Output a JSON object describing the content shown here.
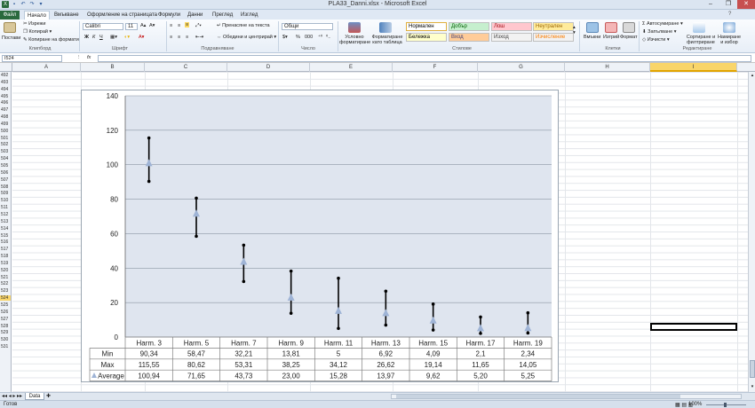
{
  "window": {
    "title": "PLA33_Danni.xlsx - Microsoft Excel",
    "controls": [
      "–",
      "❐",
      "✕"
    ]
  },
  "tabs": [
    "Файл",
    "Начало",
    "Вмъкване",
    "Оформление на страницата",
    "Формули",
    "Данни",
    "Преглед",
    "Изглед"
  ],
  "ribbon": {
    "clipboard": {
      "paste": "Постави",
      "cut": "Изрежи",
      "copy": "Копирай",
      "format_painter": "Копиране на формати",
      "label": "Клипборд"
    },
    "font": {
      "name": "Calibri",
      "size": "11",
      "label": "Шрифт"
    },
    "alignment": {
      "wrap": "Пренасяне на текста",
      "merge": "Обедини и центрирай",
      "label": "Подравняване"
    },
    "number": {
      "format": "Общи",
      "percent": "%",
      "comma": "000",
      "label": "Число"
    },
    "styles": {
      "conditional": "Условно форматиране",
      "as_table": "Форматиране като таблица",
      "label": "Стилове",
      "cells": [
        {
          "name": "Нормален",
          "bg": "#ffffff",
          "fg": "#000000"
        },
        {
          "name": "Добър",
          "bg": "#c6efce",
          "fg": "#006100"
        },
        {
          "name": "Лош",
          "bg": "#ffc7ce",
          "fg": "#9c0006"
        },
        {
          "name": "Неутрален",
          "bg": "#ffeb9c",
          "fg": "#9c6500"
        },
        {
          "name": "Бележка",
          "bg": "#ffffcc",
          "fg": "#000000"
        },
        {
          "name": "Вход",
          "bg": "#ffcc99",
          "fg": "#3f3f76"
        },
        {
          "name": "Изход",
          "bg": "#f2f2f2",
          "fg": "#3f3f3f"
        },
        {
          "name": "Изчисление",
          "bg": "#f2f2f2",
          "fg": "#fa7d00"
        }
      ]
    },
    "cells": {
      "insert": "Вмъкни",
      "delete": "Изтрий",
      "format": "Формат",
      "label": "Клетки"
    },
    "editing": {
      "autosum": "Автосумиране",
      "fill": "Запълване",
      "clear": "Изчисти",
      "sort": "Сортиране и филтриране",
      "find": "Намиране и избор",
      "label": "Редактиране"
    }
  },
  "formula_bar": {
    "name_box": "I524",
    "fx": "fx",
    "value": ""
  },
  "columns": [
    "A",
    "B",
    "C",
    "D",
    "E",
    "F",
    "G",
    "H",
    "I"
  ],
  "rows": [
    "492",
    "493",
    "494",
    "495",
    "496",
    "497",
    "498",
    "499",
    "500",
    "501",
    "502",
    "503",
    "504",
    "505",
    "506",
    "507",
    "508",
    "509",
    "510",
    "511",
    "512",
    "513",
    "514",
    "515",
    "516",
    "517",
    "518",
    "519",
    "520",
    "521",
    "522",
    "523",
    "524",
    "525",
    "526",
    "527",
    "528",
    "529",
    "530",
    "531"
  ],
  "sheet_tab": "Data",
  "status": {
    "ready": "Готов",
    "zoom": "100%"
  },
  "chart_data": {
    "type": "table",
    "chart_kind": "stock high-low-average with data table",
    "categories": [
      "Harm. 3",
      "Harm. 5",
      "Harm. 7",
      "Harm. 9",
      "Harm. 11",
      "Harm. 13",
      "Harm. 15",
      "Harm. 17",
      "Harm. 19"
    ],
    "series": [
      {
        "name": "Min",
        "labels": [
          "90,34",
          "58,47",
          "32,21",
          "13,81",
          "5",
          "6,92",
          "4,09",
          "2,1",
          "2,34"
        ],
        "values": [
          90.34,
          58.47,
          32.21,
          13.81,
          5,
          6.92,
          4.09,
          2.1,
          2.34
        ]
      },
      {
        "name": "Max",
        "labels": [
          "115,55",
          "80,62",
          "53,31",
          "38,25",
          "34,12",
          "26,62",
          "19,14",
          "11,65",
          "14,05"
        ],
        "values": [
          115.55,
          80.62,
          53.31,
          38.25,
          34.12,
          26.62,
          19.14,
          11.65,
          14.05
        ]
      },
      {
        "name": "Average",
        "labels": [
          "100,94",
          "71,65",
          "43,73",
          "23,00",
          "15,28",
          "13,97",
          "9,62",
          "5,20",
          "5,25"
        ],
        "values": [
          100.94,
          71.65,
          43.73,
          23.0,
          15.28,
          13.97,
          9.62,
          5.2,
          5.25
        ]
      }
    ],
    "y_ticks": [
      "0",
      "20",
      "40",
      "60",
      "80",
      "100",
      "120",
      "140"
    ],
    "ylim": [
      0,
      140
    ],
    "grid": true,
    "plot_bg": "#dfe5ef",
    "marker_color": "#9fb4d6"
  }
}
